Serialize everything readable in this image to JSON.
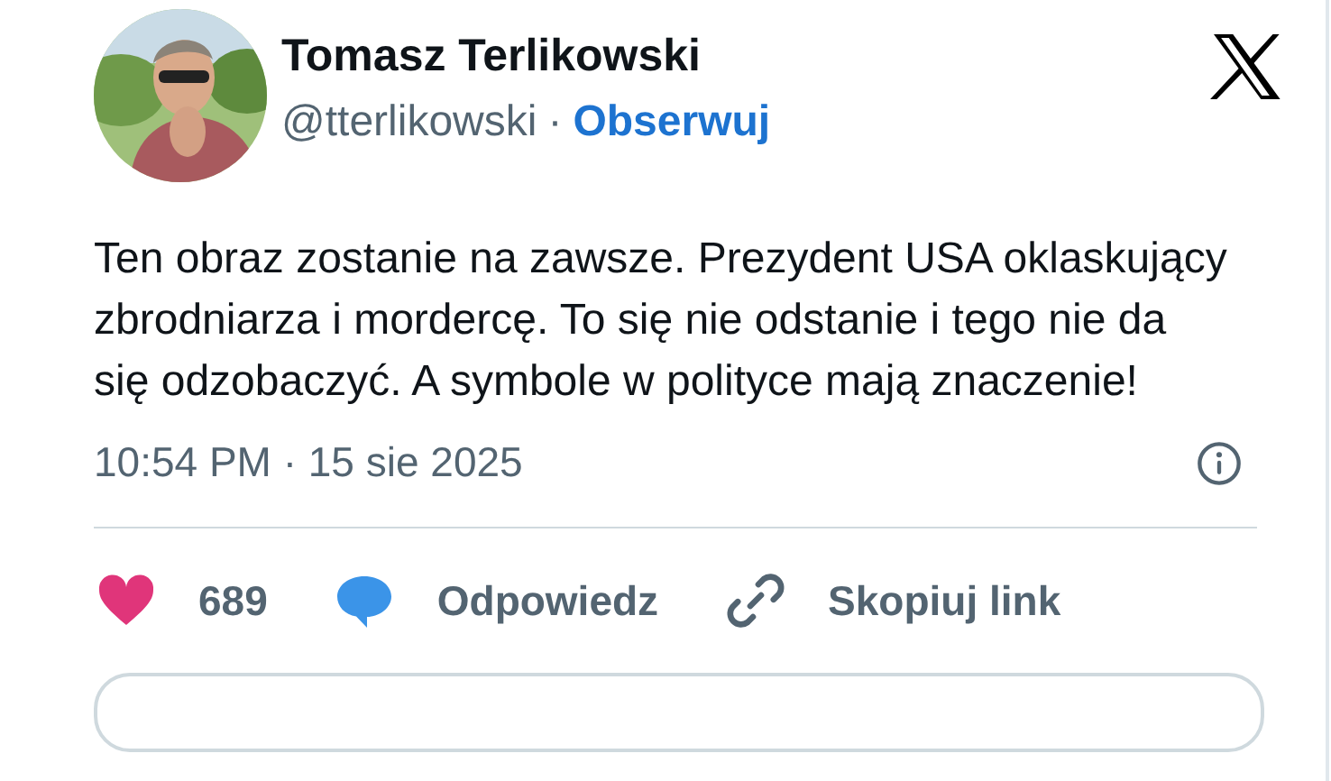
{
  "author": {
    "name": "Tomasz Terlikowski",
    "handle": "@tterlikowski",
    "separator": "·",
    "follow": "Obserwuj"
  },
  "text": "Ten obraz zostanie na zawsze. Prezydent USA oklaskujący zbrodniarza i mordercę. To się nie odstanie i tego nie da się odzobaczyć. A symbole w polityce mają znaczenie!",
  "timestamp": "10:54 PM · 15 sie 2025",
  "actions": [
    {
      "kind": "like",
      "label": "689"
    },
    {
      "kind": "reply",
      "label": "Odpowiedz"
    },
    {
      "kind": "copy",
      "label": "Skopiuj link"
    }
  ]
}
